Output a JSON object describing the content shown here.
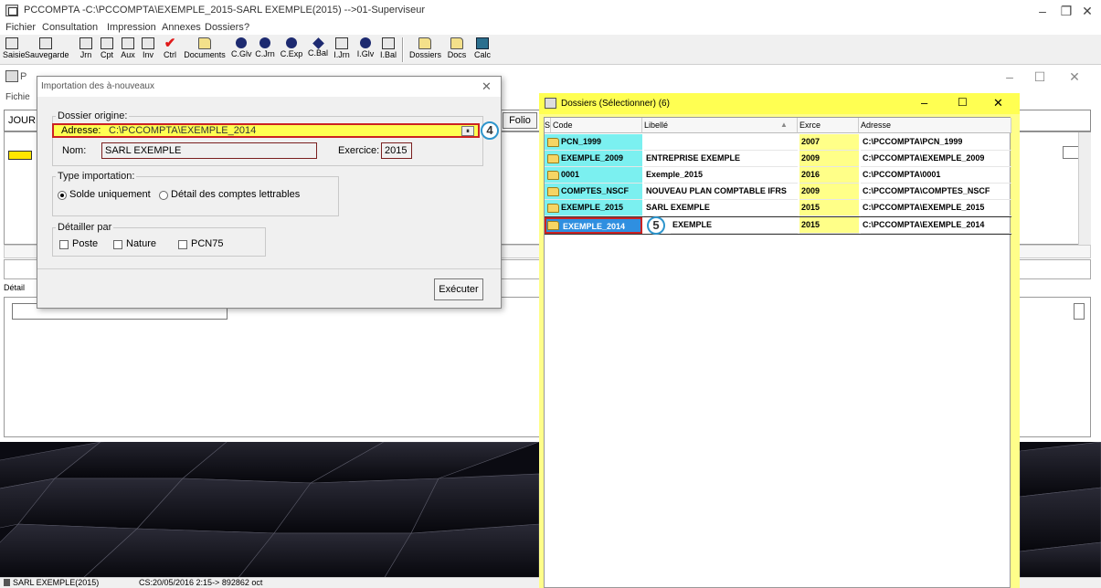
{
  "window": {
    "title": "PCCOMPTA -C:\\PCCOMPTA\\EXEMPLE_2015-SARL EXEMPLE(2015) -->01-Superviseur",
    "minimize": "–",
    "maximize": "❐",
    "close": "✕"
  },
  "menu": [
    "Fichier",
    "Consultation",
    "Impression",
    "Annexes",
    "Dossiers",
    "?"
  ],
  "toolbar": {
    "saisie": "Saisie",
    "sauvegarde": "Sauvegarde",
    "jrn": "Jrn",
    "cpt": "Cpt",
    "aux": "Aux",
    "inv": "Inv",
    "ctrl": "Ctrl",
    "documents": "Documents",
    "cglv": "C.Glv",
    "cjrn": "C.Jrn",
    "cexp": "C.Exp",
    "cbal": "C.Bal",
    "ijrn": "I.Jrn",
    "iglv": "I.Glv",
    "ibal": "I.Bal",
    "dossiers": "Dossiers",
    "docs": "Docs",
    "calc": "Calc"
  },
  "inner": {
    "title_fragment": "P",
    "menu_fragment": "Fichie",
    "jour_fragment": "JOUR",
    "folio": "Folio",
    "detail_fragment": "Détail"
  },
  "import_dialog": {
    "title": "Importation des à-nouveaux",
    "close": "✕",
    "group_origin": "Dossier origine:",
    "adresse_label": "Adresse:",
    "adresse_value": "C:\\PCCOMPTA\\EXEMPLE_2014",
    "nom_label": "Nom:",
    "nom_value": "SARL EXEMPLE",
    "exercice_label": "Exercice:",
    "exercice_value": "2015",
    "group_type": "Type importation:",
    "radio_solde": "Solde uniquement",
    "radio_detail": "Détail des comptes lettrables",
    "group_detail": "Détailler par",
    "chk_poste": "Poste",
    "chk_nature": "Nature",
    "chk_pcn75": "PCN75",
    "execute": "Exécuter",
    "callout": "4"
  },
  "dossiers": {
    "title": "Dossiers (Sélectionner) (6)",
    "minimize": "–",
    "maximize": "☐",
    "close": "✕",
    "columns": [
      "Se",
      "Code",
      "Libellé",
      "Exrce",
      "Adresse"
    ],
    "rows": [
      {
        "code": "PCN_1999",
        "libelle": "",
        "exrce": "2007",
        "adresse": "C:\\PCCOMPTA\\PCN_1999"
      },
      {
        "code": "EXEMPLE_2009",
        "libelle": "ENTREPRISE EXEMPLE",
        "exrce": "2009",
        "adresse": "C:\\PCCOMPTA\\EXEMPLE_2009"
      },
      {
        "code": "0001",
        "libelle": "Exemple_2015",
        "exrce": "2016",
        "adresse": "C:\\PCCOMPTA\\0001"
      },
      {
        "code": "COMPTES_NSCF",
        "libelle": "NOUVEAU PLAN COMPTABLE IFRS",
        "exrce": "2009",
        "adresse": "C:\\PCCOMPTA\\COMPTES_NSCF"
      },
      {
        "code": "EXEMPLE_2015",
        "libelle": "SARL EXEMPLE",
        "exrce": "2015",
        "adresse": "C:\\PCCOMPTA\\EXEMPLE_2015"
      },
      {
        "code": "EXEMPLE_2014",
        "libelle": "EXEMPLE",
        "exrce": "2015",
        "adresse": "C:\\PCCOMPTA\\EXEMPLE_2014"
      }
    ],
    "callout": "5"
  },
  "status": {
    "left": "SARL EXEMPLE(2015)",
    "right": "CS:20/05/2016  2:15-> 892862 oct"
  },
  "colors": {
    "highlight_yellow": "#ffff52",
    "code_cyan": "#7bf0f0",
    "callout_blue": "#2e95cc",
    "red_frame": "#cc2222"
  }
}
